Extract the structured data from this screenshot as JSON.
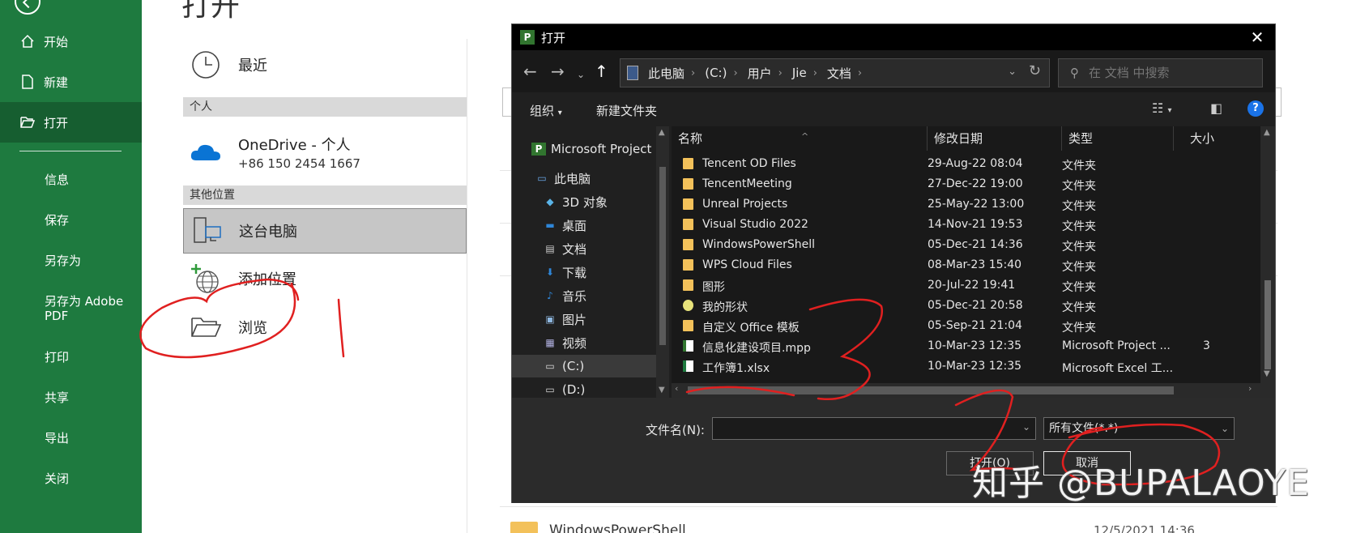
{
  "backstage": {
    "page_title": "打开",
    "nav": [
      {
        "label": "开始",
        "icon": "home-icon"
      },
      {
        "label": "新建",
        "icon": "new-file-icon"
      },
      {
        "label": "打开",
        "icon": "open-folder-icon"
      },
      {
        "label": "信息"
      },
      {
        "label": "保存"
      },
      {
        "label": "另存为"
      },
      {
        "label": "另存为 Adobe PDF"
      },
      {
        "label": "打印"
      },
      {
        "label": "共享"
      },
      {
        "label": "导出"
      },
      {
        "label": "关闭"
      }
    ],
    "recent": "最近",
    "section_personal": "个人",
    "onedrive_name": "OneDrive - 个人",
    "onedrive_phone": "+86 150 2454 1667",
    "section_other": "其他位置",
    "this_pc": "这台电脑",
    "add_place": "添加位置",
    "browse": "浏览",
    "bg_folder": {
      "name": "WindowsPowerShell",
      "date": "12/5/2021 14:36"
    }
  },
  "dialog": {
    "title": "打开",
    "breadcrumb": [
      "此电脑",
      "(C:)",
      "用户",
      "Jie",
      "文档"
    ],
    "search_placeholder": "在 文档 中搜索",
    "toolbar": {
      "organize": "组织",
      "new_folder": "新建文件夹"
    },
    "nav_pane": [
      {
        "label": "Microsoft Project",
        "icon": "project-icon"
      },
      {
        "label": "此电脑",
        "icon": "computer-icon"
      },
      {
        "label": "3D 对象",
        "icon": "cube-icon"
      },
      {
        "label": "桌面",
        "icon": "desktop-icon"
      },
      {
        "label": "文档",
        "icon": "document-icon"
      },
      {
        "label": "下载",
        "icon": "download-icon"
      },
      {
        "label": "音乐",
        "icon": "music-icon"
      },
      {
        "label": "图片",
        "icon": "picture-icon"
      },
      {
        "label": "视频",
        "icon": "video-icon"
      },
      {
        "label": "(C:)",
        "icon": "drive-icon"
      },
      {
        "label": "(D:)",
        "icon": "drive-icon"
      }
    ],
    "columns": {
      "name": "名称",
      "date": "修改日期",
      "type": "类型",
      "size": "大小"
    },
    "files": [
      {
        "name": "Tencent OD Files",
        "date": "29-Aug-22 08:04",
        "type": "文件夹",
        "size": "",
        "icon": "folder"
      },
      {
        "name": "TencentMeeting",
        "date": "27-Dec-22 19:00",
        "type": "文件夹",
        "size": "",
        "icon": "folder"
      },
      {
        "name": "Unreal Projects",
        "date": "25-May-22 13:00",
        "type": "文件夹",
        "size": "",
        "icon": "folder"
      },
      {
        "name": "Visual Studio 2022",
        "date": "14-Nov-21 19:53",
        "type": "文件夹",
        "size": "",
        "icon": "folder"
      },
      {
        "name": "WindowsPowerShell",
        "date": "05-Dec-21 14:36",
        "type": "文件夹",
        "size": "",
        "icon": "folder"
      },
      {
        "name": "WPS Cloud Files",
        "date": "08-Mar-23 15:40",
        "type": "文件夹",
        "size": "",
        "icon": "folder"
      },
      {
        "name": "图形",
        "date": "20-Jul-22 19:41",
        "type": "文件夹",
        "size": "",
        "icon": "folder"
      },
      {
        "name": "我的形状",
        "date": "05-Dec-21 20:58",
        "type": "文件夹",
        "size": "",
        "icon": "shape"
      },
      {
        "name": "自定义 Office 模板",
        "date": "05-Sep-21 21:04",
        "type": "文件夹",
        "size": "",
        "icon": "folder"
      },
      {
        "name": "信息化建设项目.mpp",
        "date": "10-Mar-23 12:35",
        "type": "Microsoft Project ...",
        "size": "3",
        "icon": "mpp"
      },
      {
        "name": "工作簿1.xlsx",
        "date": "10-Mar-23 12:35",
        "type": "Microsoft Excel 工...",
        "size": "",
        "icon": "xlsx"
      }
    ],
    "filename_label": "文件名(N):",
    "filetype": "所有文件(*.*)",
    "open_btn": "打开(O)",
    "cancel_btn": "取消"
  },
  "watermark": "知乎 @BUPALAOYE",
  "colors": {
    "excel_green": "#1e7a3f",
    "excel_green_active": "#165e30",
    "dialog_bg": "#202020",
    "annotation_red": "#e02020"
  }
}
